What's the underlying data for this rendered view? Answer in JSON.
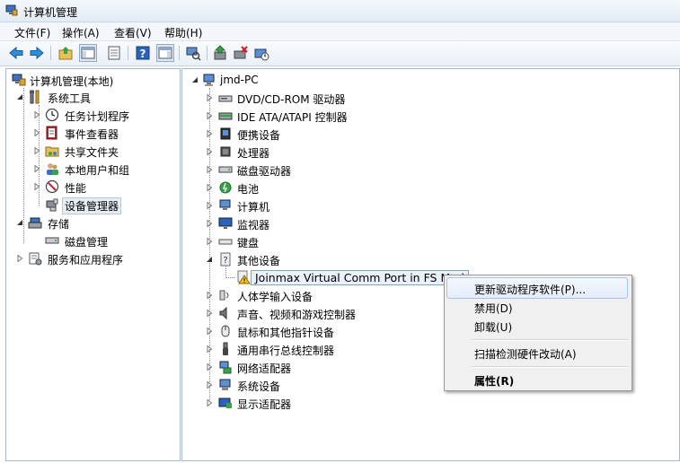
{
  "window": {
    "title": "计算机管理"
  },
  "menubar": [
    "文件(F)",
    "操作(A)",
    "查看(V)",
    "帮助(H)"
  ],
  "toolbar": {
    "buttons": [
      "back-arrow-icon",
      "forward-arrow-icon",
      "up-folder-icon",
      "show-tree-icon",
      "properties-icon",
      "help-icon",
      "show-action-pane-icon",
      "scan-hardware-icon",
      "update-driver-icon",
      "uninstall-icon",
      "disable-icon"
    ]
  },
  "left_tree": {
    "root": "计算机管理(本地)",
    "system_tools": "系统工具",
    "task_scheduler": "任务计划程序",
    "event_viewer": "事件查看器",
    "shared_folders": "共享文件夹",
    "local_users": "本地用户和组",
    "performance": "性能",
    "device_manager": "设备管理器",
    "storage": "存储",
    "disk_management": "磁盘管理",
    "services_apps": "服务和应用程序"
  },
  "device_tree": {
    "computer": "jmd-PC",
    "categories_top": [
      "DVD/CD-ROM 驱动器",
      "IDE ATA/ATAPI 控制器",
      "便携设备",
      "处理器",
      "磁盘驱动器",
      "电池",
      "计算机",
      "监视器",
      "键盘"
    ],
    "other_devices": "其他设备",
    "selected_device": "Joinmax Virtual Comm Port in FS Mod",
    "categories_bottom": [
      "人体学输入设备",
      "声音、视频和游戏控制器",
      "鼠标和其他指针设备",
      "通用串行总线控制器",
      "网络适配器",
      "系统设备",
      "显示适配器"
    ]
  },
  "context_menu": {
    "update_driver": "更新驱动程序软件(P)...",
    "disable": "禁用(D)",
    "uninstall": "卸载(U)",
    "scan": "扫描检测硬件改动(A)",
    "properties": "属性(R)"
  }
}
